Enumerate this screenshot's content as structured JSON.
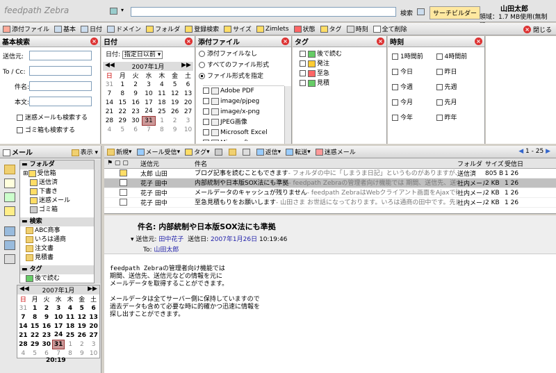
{
  "app": {
    "logo": "feedpath Zebra",
    "search_label": "検索",
    "search_builder": "サーチビルダー",
    "user_name": "山田太郎",
    "usage": "領域：1.7 MB使用(無制限)"
  },
  "toolbar": {
    "items": [
      "添付ファイル",
      "基本",
      "日付",
      "ドメイン",
      "フォルダ",
      "登録検索",
      "サイズ",
      "Zimlets",
      "状態",
      "タグ",
      "時刻",
      "全て削除"
    ],
    "close": "閉じる"
  },
  "basic": {
    "title": "基本検索",
    "from": "送信元:",
    "tocc": "To / Cc:",
    "subject": "件名:",
    "body": "本文:",
    "opt1": "迷惑メールも検索する",
    "opt2": "ゴミ箱も検索する"
  },
  "date": {
    "title": "日付",
    "label": "日付:",
    "select": "指定日以前",
    "month": "2007年1月",
    "dow": [
      "日",
      "月",
      "火",
      "水",
      "木",
      "金",
      "土"
    ],
    "weeks": [
      [
        "31",
        "1",
        "2",
        "3",
        "4",
        "5",
        "6"
      ],
      [
        "7",
        "8",
        "9",
        "10",
        "11",
        "12",
        "13"
      ],
      [
        "14",
        "15",
        "16",
        "17",
        "18",
        "19",
        "20"
      ],
      [
        "21",
        "22",
        "23",
        "24",
        "25",
        "26",
        "27"
      ],
      [
        "28",
        "29",
        "30",
        "31",
        "1",
        "2",
        "3"
      ],
      [
        "4",
        "5",
        "6",
        "7",
        "8",
        "9",
        "10"
      ]
    ]
  },
  "attach": {
    "title": "添付ファイル",
    "opts": [
      "添付ファイルなし",
      "すべてのファイル形式",
      "ファイル形式を指定"
    ],
    "types": [
      "Adobe PDF",
      "image/pjpeg",
      "image/x-png",
      "JPEG画像",
      "Microsoft Excel",
      "Microsoft PowerPoint"
    ]
  },
  "tag": {
    "title": "タグ",
    "items": [
      "後で読む",
      "発注",
      "至急",
      "見積"
    ]
  },
  "time": {
    "title": "時刻",
    "left": [
      "1時間前",
      "今日",
      "今週",
      "今月",
      "今年"
    ],
    "right": [
      "4時間前",
      "昨日",
      "先週",
      "先月",
      "昨年"
    ]
  },
  "sidebar": {
    "title": "メール",
    "view": "表示",
    "folders_h": "フォルダ",
    "folders": [
      "受信箱",
      "送信済",
      "下書き",
      "迷惑メール",
      "ゴミ箱"
    ],
    "search_h": "検索",
    "searches": [
      "ABC商事",
      "いろは通商",
      "注文書",
      "見積書"
    ],
    "tag_h": "タグ",
    "tag_first": "後で読む",
    "month": "2007年1月",
    "clock": "20:19"
  },
  "mailbar": {
    "new": "新規",
    "get": "メール受信",
    "tag": "タグ",
    "reply": "返信",
    "fwd": "転送",
    "spam": "迷惑メール",
    "page": "1 - 25"
  },
  "cols": {
    "from": "送信元",
    "subject": "件名",
    "folder": "フォルダ",
    "size": "サイズ",
    "date": "受信日"
  },
  "mails": [
    {
      "from": "太郎 山田",
      "subject": "ブログ記事を読むこともできます",
      "preview": " - フォルダの中に「しまうま日記」というものがありますが、これはRSSフィードになっていて",
      "folder": "送信済",
      "size": "805 B",
      "date": "1 26"
    },
    {
      "from": "花子 田中",
      "subject": "内部統制や日本版SOX法にも準拠",
      "preview": " - feedpath Zebraの管理者向け機能では 期間、送信先、送信元などの情報",
      "folder": "社内メール",
      "size": "2 KB",
      "date": "1 26"
    },
    {
      "from": "花子 田中",
      "subject": "メールデータのキャッシュが残りません",
      "preview": " - feedpath ZebraはWebクライアント画面をAjaxで動的に生成するため、クラ",
      "folder": "社内メール",
      "size": "2 KB",
      "date": "1 26"
    },
    {
      "from": "花子 田中",
      "subject": "至急見積もりをお願いします",
      "preview": " - 山田さま お世話になっております。いろは通商の田中です。先日ご依頼して確認した",
      "folder": "社内メール",
      "size": "2 KB",
      "date": "1 26"
    }
  ],
  "reading": {
    "subject": "件名: 内部統制や日本版SOX法にも準拠",
    "from_label": "送信元:",
    "from": "田中花子",
    "date_label": "送信日:",
    "date": "2007年1月26日",
    "time": "10:19:46",
    "to_label": "To:",
    "to": "山田太郎",
    "body": [
      "feedpath Zebraの管理者向け機能では",
      "期間、送信先、送信元などの情報を元に",
      "メールデータを取得することができます。",
      "",
      "メールデータは全てサーバー側に保持していますので",
      "過去データも含めて必要な時に的確かつ迅速に情報を",
      "探し出すことができます。"
    ]
  }
}
